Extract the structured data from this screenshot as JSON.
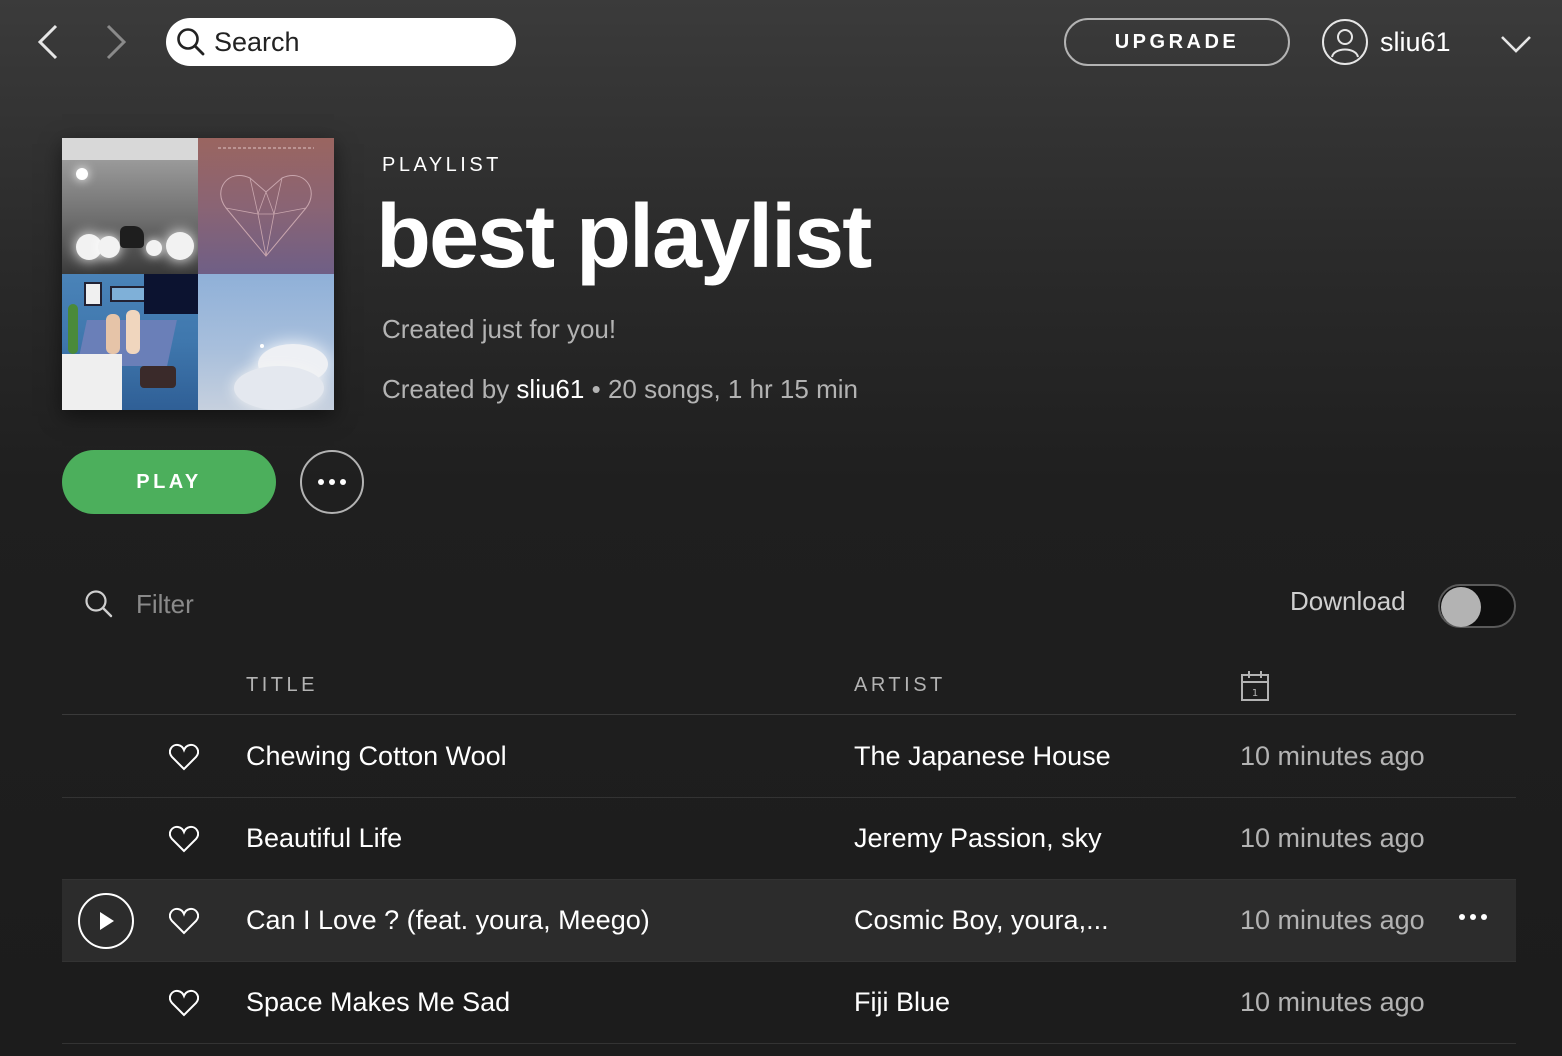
{
  "topbar": {
    "back_icon": "chevron-left-icon",
    "forward_icon": "chevron-right-icon",
    "search_placeholder": "Search",
    "upgrade_label": "UPGRADE",
    "username": "sliu61"
  },
  "playlist": {
    "type_label": "PLAYLIST",
    "title": "best playlist",
    "description": "Created just for you!",
    "meta_prefix": "Created by",
    "owner": "sliu61",
    "meta_separator": "•",
    "stats": "20 songs, 1 hr 15 min"
  },
  "actions": {
    "play_label": "PLAY"
  },
  "filter": {
    "placeholder": "Filter",
    "download_label": "Download",
    "download_enabled": false
  },
  "table": {
    "columns": {
      "title": "TITLE",
      "artist": "ARTIST",
      "added_icon": "calendar-icon",
      "added_icon_day": "1"
    },
    "rows": [
      {
        "title": "Chewing Cotton Wool",
        "artist": "The Japanese House",
        "added": "10 minutes ago"
      },
      {
        "title": "Beautiful Life",
        "artist": "Jeremy Passion, sky",
        "added": "10 minutes ago"
      },
      {
        "title": "Can I Love ? (feat. youra, Meego)",
        "artist": "Cosmic Boy, youra,...",
        "added": "10 minutes ago"
      },
      {
        "title": "Space Makes Me Sad",
        "artist": "Fiji Blue",
        "added": "10 minutes ago"
      }
    ]
  },
  "colors": {
    "accent_green": "#4caf5c",
    "background": "#1c1c1c",
    "muted_text": "#b3b3b3"
  }
}
